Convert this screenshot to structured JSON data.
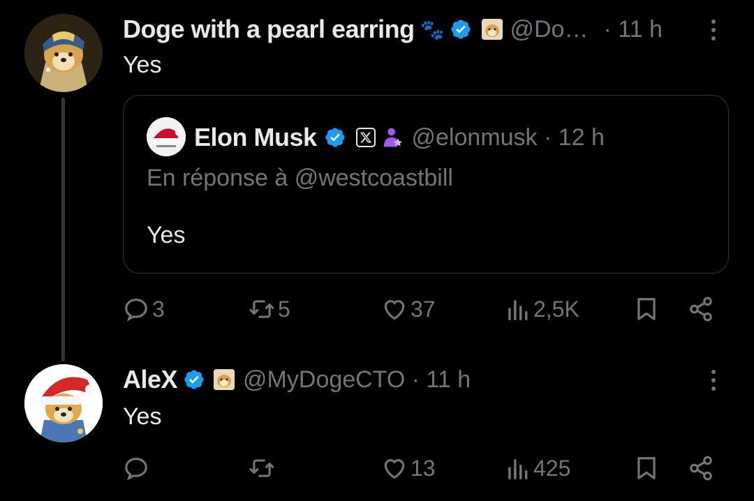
{
  "tweet1": {
    "author_name": "Doge with a pearl earring",
    "author_emoji": "🐾",
    "handle": "@Do…",
    "time": "· 11 h",
    "text": "Yes",
    "quote": {
      "author_name": "Elon Musk",
      "handle": "@elonmusk · 12 h",
      "reply_to": "En réponse à @westcoastbill",
      "text": "Yes"
    },
    "metrics": {
      "replies": "3",
      "reposts": "5",
      "likes": "37",
      "views": "2,5K"
    }
  },
  "tweet2": {
    "author_name": "AleX",
    "handle": "@MyDogeCTO · 11 h",
    "text": "Yes",
    "metrics": {
      "replies": "",
      "reposts": "",
      "likes": "13",
      "views": "425"
    }
  },
  "colors": {
    "background": "#000000",
    "text": "#e7e9ea",
    "muted": "#71767b",
    "verified": "#1d9bf0",
    "border": "#2f3336",
    "affiliate": "#a855f7"
  },
  "icons": [
    "paw-icon",
    "verified-icon",
    "doge-badge-icon",
    "x-logo-icon",
    "affiliate-icon",
    "more-icon",
    "reply-icon",
    "repost-icon",
    "like-icon",
    "views-icon",
    "bookmark-icon",
    "share-icon"
  ]
}
